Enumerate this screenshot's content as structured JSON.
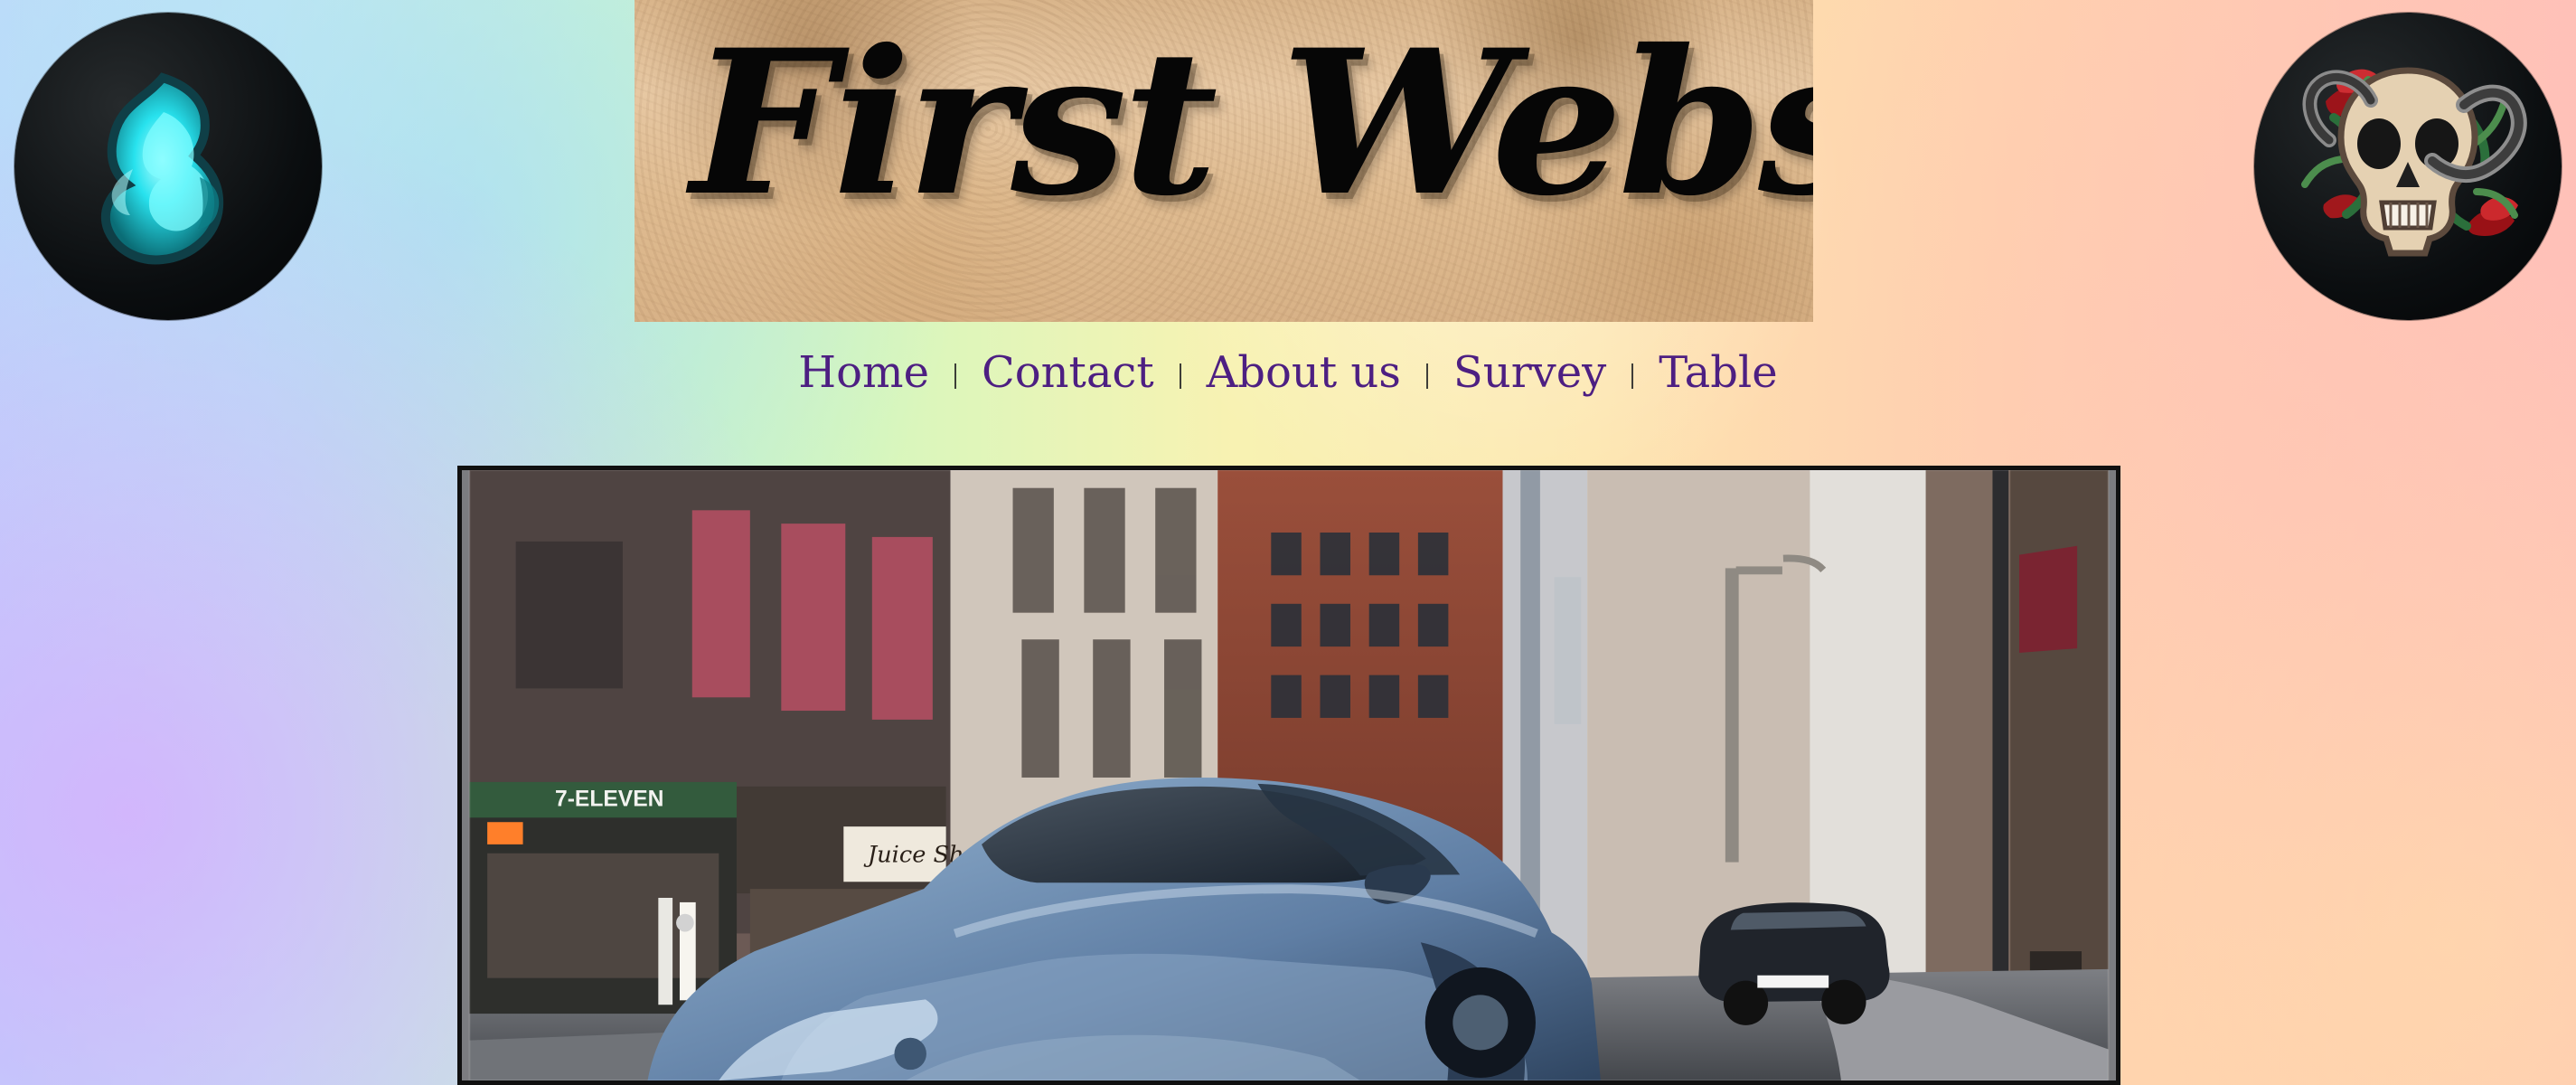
{
  "site": {
    "title": "First Website"
  },
  "navigation": {
    "items": [
      {
        "label": "Home"
      },
      {
        "label": "Contact"
      },
      {
        "label": "About us"
      },
      {
        "label": "Survey"
      },
      {
        "label": "Table"
      }
    ]
  },
  "icons": {
    "left_avatar": "flame-icon",
    "right_avatar": "skull-rose-icon"
  },
  "hero": {
    "store_labels": [
      "7-ELEVEN",
      "Juice Shop"
    ]
  },
  "colors": {
    "nav_link": "#4d1f82",
    "title": "#060606"
  }
}
